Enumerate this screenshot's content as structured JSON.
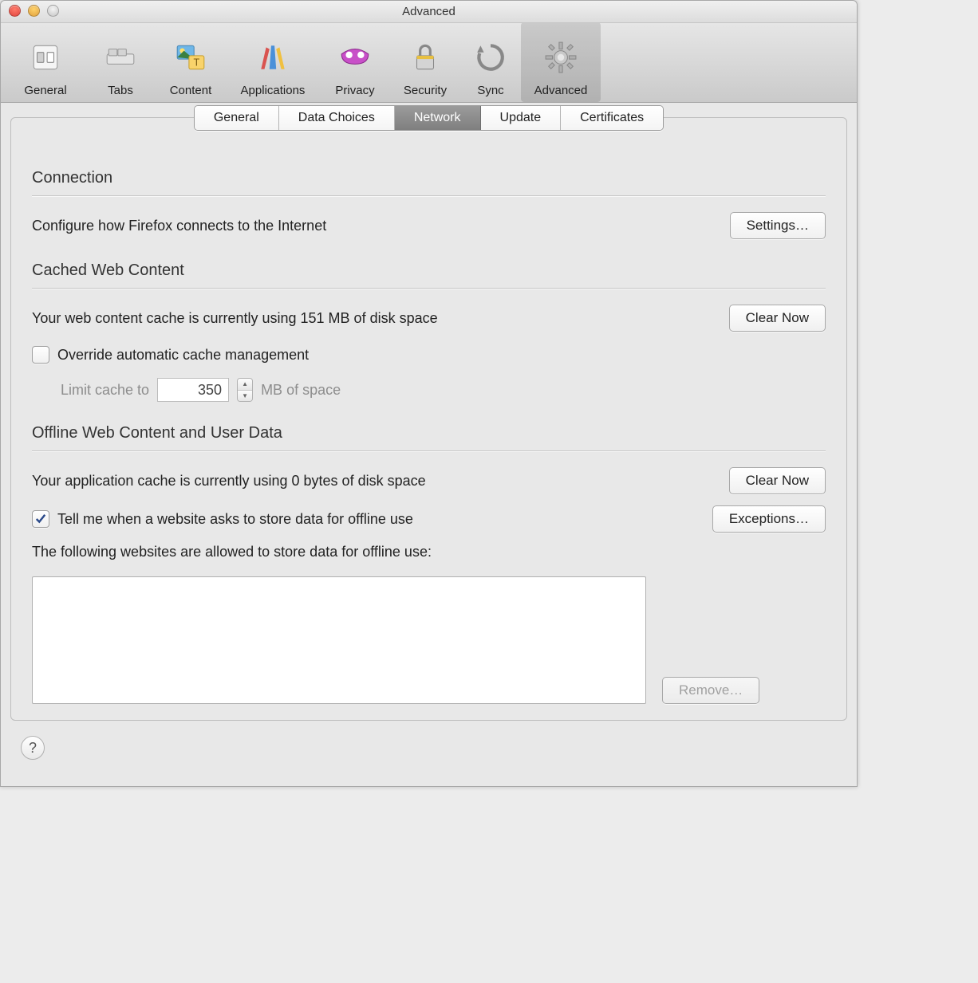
{
  "window": {
    "title": "Advanced"
  },
  "toolbar": {
    "items": [
      {
        "label": "General"
      },
      {
        "label": "Tabs"
      },
      {
        "label": "Content"
      },
      {
        "label": "Applications"
      },
      {
        "label": "Privacy"
      },
      {
        "label": "Security"
      },
      {
        "label": "Sync"
      },
      {
        "label": "Advanced"
      }
    ]
  },
  "subtabs": {
    "items": [
      {
        "label": "General"
      },
      {
        "label": "Data Choices"
      },
      {
        "label": "Network"
      },
      {
        "label": "Update"
      },
      {
        "label": "Certificates"
      }
    ],
    "active_index": 2
  },
  "sections": {
    "connection": {
      "title": "Connection",
      "desc": "Configure how Firefox connects to the Internet",
      "settings_btn": "Settings…"
    },
    "cache": {
      "title": "Cached Web Content",
      "usage": "Your web content cache is currently using 151 MB of disk space",
      "clear_btn": "Clear Now",
      "override_label": "Override automatic cache management",
      "override_checked": false,
      "limit_prefix": "Limit cache to",
      "limit_value": "350",
      "limit_suffix": "MB of space"
    },
    "offline": {
      "title": "Offline Web Content and User Data",
      "usage": "Your application cache is currently using 0 bytes of disk space",
      "clear_btn": "Clear Now",
      "tell_label": "Tell me when a website asks to store data for offline use",
      "tell_checked": true,
      "exceptions_btn": "Exceptions…",
      "list_desc": "The following websites are allowed to store data for offline use:",
      "remove_btn": "Remove…"
    }
  },
  "help_btn": "?"
}
